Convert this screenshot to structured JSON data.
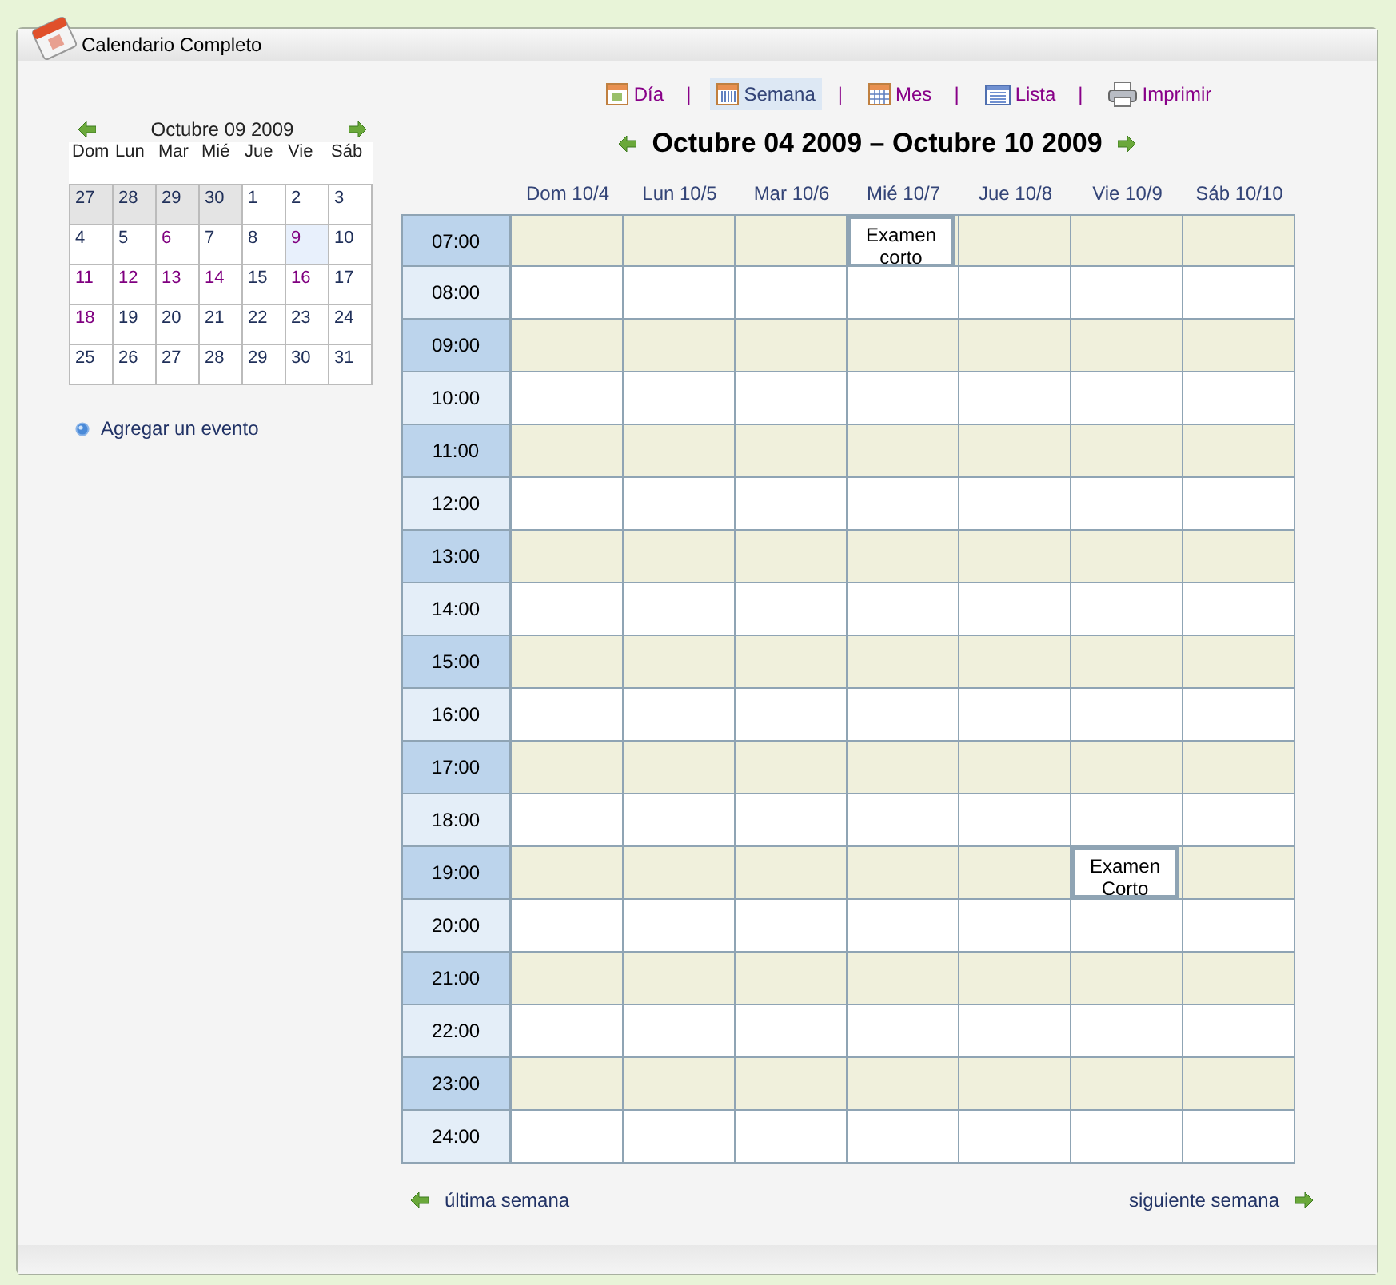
{
  "window": {
    "title": "Calendario Completo"
  },
  "views": [
    {
      "label": "Día",
      "kind": "day",
      "selected": false,
      "separator": "|"
    },
    {
      "label": "Semana",
      "kind": "week",
      "selected": true,
      "separator": "|"
    },
    {
      "label": "Mes",
      "kind": "month",
      "selected": false,
      "separator": "|"
    },
    {
      "label": "Lista",
      "kind": "list",
      "selected": false,
      "separator": "|"
    },
    {
      "label": "Imprimir",
      "kind": "print",
      "selected": false
    }
  ],
  "mini_calendar": {
    "title": "Octubre 09 2009",
    "weekdays": [
      "Dom",
      "Lun",
      "Mar",
      "Mié",
      "Jue",
      "Vie",
      "Sáb"
    ],
    "weeks": [
      [
        {
          "day": "27",
          "other_month": true,
          "visited": false,
          "selected": false
        },
        {
          "day": "28",
          "other_month": true,
          "visited": false,
          "selected": false
        },
        {
          "day": "29",
          "other_month": true,
          "visited": false,
          "selected": false
        },
        {
          "day": "30",
          "other_month": true,
          "visited": false,
          "selected": false
        },
        {
          "day": "1",
          "other_month": false,
          "visited": false,
          "selected": false
        },
        {
          "day": "2",
          "other_month": false,
          "visited": false,
          "selected": false
        },
        {
          "day": "3",
          "other_month": false,
          "visited": false,
          "selected": false
        }
      ],
      [
        {
          "day": "4",
          "other_month": false,
          "visited": false,
          "selected": false
        },
        {
          "day": "5",
          "other_month": false,
          "visited": false,
          "selected": false
        },
        {
          "day": "6",
          "other_month": false,
          "visited": true,
          "selected": false
        },
        {
          "day": "7",
          "other_month": false,
          "visited": false,
          "selected": false
        },
        {
          "day": "8",
          "other_month": false,
          "visited": false,
          "selected": false
        },
        {
          "day": "9",
          "other_month": false,
          "visited": true,
          "selected": true
        },
        {
          "day": "10",
          "other_month": false,
          "visited": false,
          "selected": false
        }
      ],
      [
        {
          "day": "11",
          "other_month": false,
          "visited": true,
          "selected": false
        },
        {
          "day": "12",
          "other_month": false,
          "visited": true,
          "selected": false
        },
        {
          "day": "13",
          "other_month": false,
          "visited": true,
          "selected": false
        },
        {
          "day": "14",
          "other_month": false,
          "visited": true,
          "selected": false
        },
        {
          "day": "15",
          "other_month": false,
          "visited": false,
          "selected": false
        },
        {
          "day": "16",
          "other_month": false,
          "visited": true,
          "selected": false
        },
        {
          "day": "17",
          "other_month": false,
          "visited": false,
          "selected": false
        }
      ],
      [
        {
          "day": "18",
          "other_month": false,
          "visited": true,
          "selected": false
        },
        {
          "day": "19",
          "other_month": false,
          "visited": false,
          "selected": false
        },
        {
          "day": "20",
          "other_month": false,
          "visited": false,
          "selected": false
        },
        {
          "day": "21",
          "other_month": false,
          "visited": false,
          "selected": false
        },
        {
          "day": "22",
          "other_month": false,
          "visited": false,
          "selected": false
        },
        {
          "day": "23",
          "other_month": false,
          "visited": false,
          "selected": false
        },
        {
          "day": "24",
          "other_month": false,
          "visited": false,
          "selected": false
        }
      ],
      [
        {
          "day": "25",
          "other_month": false,
          "visited": false,
          "selected": false
        },
        {
          "day": "26",
          "other_month": false,
          "visited": false,
          "selected": false
        },
        {
          "day": "27",
          "other_month": false,
          "visited": false,
          "selected": false
        },
        {
          "day": "28",
          "other_month": false,
          "visited": false,
          "selected": false
        },
        {
          "day": "29",
          "other_month": false,
          "visited": false,
          "selected": false
        },
        {
          "day": "30",
          "other_month": false,
          "visited": false,
          "selected": false
        },
        {
          "day": "31",
          "other_month": false,
          "visited": false,
          "selected": false
        }
      ]
    ]
  },
  "add_event": "Agregar un evento",
  "week_title": "Octubre 04 2009 – Octubre 10 2009",
  "columns": [
    "Dom 10/4",
    "Lun 10/5",
    "Mar 10/6",
    "Mié 10/7",
    "Jue 10/8",
    "Vie 10/9",
    "Sáb 10/10"
  ],
  "hours": [
    {
      "time": "07:00",
      "cells": [
        {},
        {},
        {},
        {
          "event": "Examen corto"
        },
        {},
        {},
        {}
      ]
    },
    {
      "time": "08:00",
      "cells": [
        {},
        {},
        {},
        {},
        {},
        {},
        {}
      ]
    },
    {
      "time": "09:00",
      "cells": [
        {},
        {},
        {},
        {},
        {},
        {},
        {}
      ]
    },
    {
      "time": "10:00",
      "cells": [
        {},
        {},
        {},
        {},
        {},
        {},
        {}
      ]
    },
    {
      "time": "11:00",
      "cells": [
        {},
        {},
        {},
        {},
        {},
        {},
        {}
      ]
    },
    {
      "time": "12:00",
      "cells": [
        {},
        {},
        {},
        {},
        {},
        {},
        {}
      ]
    },
    {
      "time": "13:00",
      "cells": [
        {},
        {},
        {},
        {},
        {},
        {},
        {}
      ]
    },
    {
      "time": "14:00",
      "cells": [
        {},
        {},
        {},
        {},
        {},
        {},
        {}
      ]
    },
    {
      "time": "15:00",
      "cells": [
        {},
        {},
        {},
        {},
        {},
        {},
        {}
      ]
    },
    {
      "time": "16:00",
      "cells": [
        {},
        {},
        {},
        {},
        {},
        {},
        {}
      ]
    },
    {
      "time": "17:00",
      "cells": [
        {},
        {},
        {},
        {},
        {},
        {},
        {}
      ]
    },
    {
      "time": "18:00",
      "cells": [
        {},
        {},
        {},
        {},
        {},
        {},
        {}
      ]
    },
    {
      "time": "19:00",
      "cells": [
        {},
        {},
        {},
        {},
        {},
        {
          "event": "Examen Corto"
        },
        {}
      ]
    },
    {
      "time": "20:00",
      "cells": [
        {},
        {},
        {},
        {},
        {},
        {},
        {}
      ]
    },
    {
      "time": "21:00",
      "cells": [
        {},
        {},
        {},
        {},
        {},
        {},
        {}
      ]
    },
    {
      "time": "22:00",
      "cells": [
        {},
        {},
        {},
        {},
        {},
        {},
        {}
      ]
    },
    {
      "time": "23:00",
      "cells": [
        {},
        {},
        {},
        {},
        {},
        {},
        {}
      ]
    },
    {
      "time": "24:00",
      "cells": [
        {},
        {},
        {},
        {},
        {},
        {},
        {}
      ]
    }
  ],
  "prev_week": "última semana",
  "next_week": "siguiente semana"
}
